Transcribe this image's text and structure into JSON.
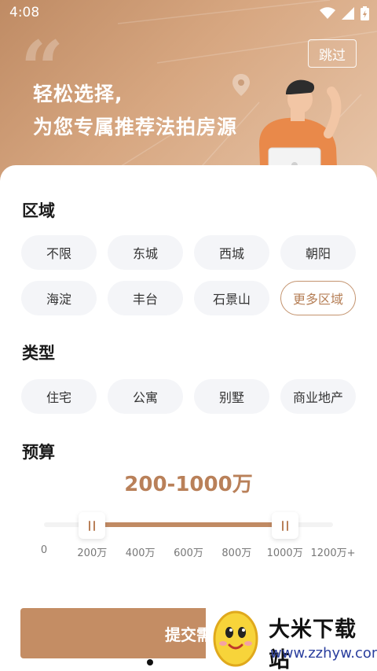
{
  "status_bar": {
    "time": "4:08"
  },
  "hero": {
    "title": "轻松选择,",
    "subtitle": "为您专属推荐法拍房源",
    "skip_label": "跳过",
    "quote_glyph": "“"
  },
  "region": {
    "title": "区域",
    "options": [
      "不限",
      "东城",
      "西城",
      "朝阳",
      "海淀",
      "丰台",
      "石景山",
      "更多区域"
    ]
  },
  "type": {
    "title": "类型",
    "options": [
      "住宅",
      "公寓",
      "别墅",
      "商业地产"
    ]
  },
  "budget": {
    "title": "预算",
    "value": "200-1000万",
    "ticks": [
      "0",
      "200万",
      "400万",
      "600万",
      "800万",
      "1000万",
      "1200万+"
    ],
    "range_min": 200,
    "range_max": 1000,
    "scale_max": 1200
  },
  "submit_label": "提交需",
  "watermark": {
    "name": "大米下载站",
    "url": "www.zzhyw.com"
  },
  "colors": {
    "accent": "#c48d64",
    "hero_start": "#bf8b64",
    "hero_end": "#e8c6aa",
    "chip_bg": "#f4f5f8"
  },
  "icons": [
    "wifi-icon",
    "signal-icon",
    "battery-icon",
    "location-pin-icon",
    "person-laptop-illustration",
    "egg-mascot-icon"
  ]
}
